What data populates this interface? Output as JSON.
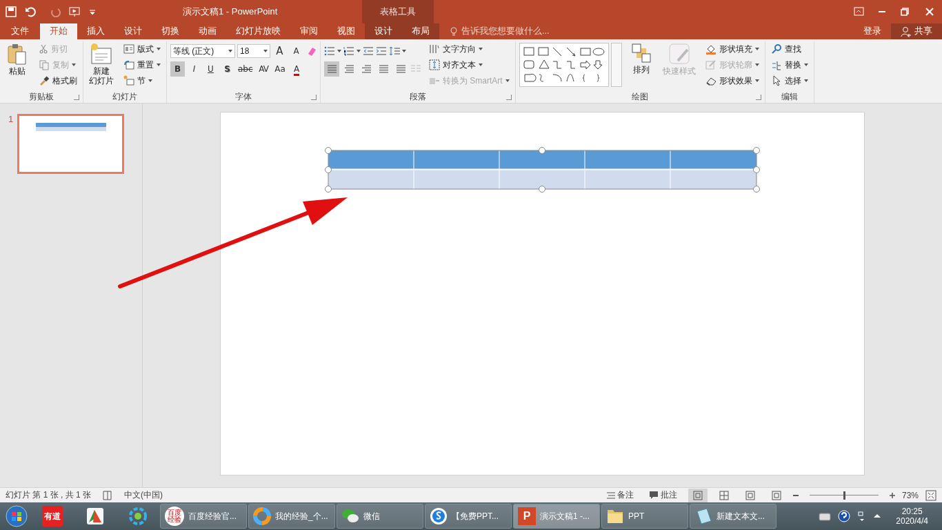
{
  "window": {
    "title": "演示文稿1 - PowerPoint",
    "context_group": "表格工具"
  },
  "tabs": [
    {
      "label": "文件",
      "kind": "file",
      "selected": false
    },
    {
      "label": "开始",
      "kind": "normal",
      "selected": true
    },
    {
      "label": "插入",
      "kind": "normal",
      "selected": false
    },
    {
      "label": "设计",
      "kind": "normal",
      "selected": false
    },
    {
      "label": "切换",
      "kind": "normal",
      "selected": false
    },
    {
      "label": "动画",
      "kind": "normal",
      "selected": false
    },
    {
      "label": "幻灯片放映",
      "kind": "normal",
      "selected": false
    },
    {
      "label": "审阅",
      "kind": "normal",
      "selected": false
    },
    {
      "label": "视图",
      "kind": "normal",
      "selected": false
    },
    {
      "label": "设计",
      "kind": "context",
      "selected": false
    },
    {
      "label": "布局",
      "kind": "context",
      "selected": false
    }
  ],
  "tell_me": {
    "placeholder": "告诉我您想要做什么..."
  },
  "account": {
    "sign_in": "登录",
    "share": "共享"
  },
  "ribbon": {
    "groups": [
      {
        "kind": "clipboard",
        "label": "剪贴板",
        "large": [
          {
            "lines": [
              "粘贴"
            ],
            "disabled": false
          }
        ],
        "small": [
          {
            "label": "剪切",
            "disabled": true
          },
          {
            "label": "复制",
            "disabled": true
          },
          {
            "label": "格式刷",
            "disabled": false
          }
        ]
      },
      {
        "kind": "slides",
        "label": "幻灯片",
        "large": [
          {
            "lines": [
              "新建",
              "幻灯片"
            ],
            "disabled": false
          }
        ],
        "small": [
          {
            "label": "版式",
            "disabled": false
          },
          {
            "label": "重置",
            "disabled": false
          },
          {
            "label": "节",
            "disabled": false
          }
        ]
      },
      {
        "kind": "font",
        "label": "字体",
        "font_name": "等线 (正文)",
        "font_size": "18",
        "size_buttons": [
          "A",
          "A"
        ],
        "format_buttons": [
          {
            "text": "B",
            "selected": true
          },
          {
            "text": "I",
            "selected": false
          },
          {
            "text": "U",
            "selected": false
          },
          {
            "text": "S",
            "selected": false
          },
          {
            "text": "abc",
            "selected": false
          },
          {
            "text": "AV",
            "selected": false
          },
          {
            "text": "Aa",
            "selected": false
          },
          {
            "text": "A",
            "selected": false
          }
        ]
      },
      {
        "kind": "paragraph",
        "label": "段落",
        "align_buttons": [
          {
            "selected": true
          },
          {
            "selected": false
          },
          {
            "selected": false
          },
          {
            "selected": false
          },
          {
            "selected": false
          }
        ],
        "small": [
          {
            "label": "文字方向",
            "disabled": false
          },
          {
            "label": "对齐文本",
            "disabled": false
          },
          {
            "label": "转换为 SmartArt",
            "disabled": true
          }
        ]
      },
      {
        "kind": "drawing",
        "label": "绘图",
        "large": [
          {
            "lines": [
              "排列"
            ],
            "disabled": false
          },
          {
            "lines": [
              "快速样式"
            ],
            "disabled": true
          }
        ],
        "small": [
          {
            "label": "形状填充",
            "disabled": false
          },
          {
            "label": "形状轮廓",
            "disabled": true
          },
          {
            "label": "形状效果",
            "disabled": false
          }
        ]
      },
      {
        "kind": "editing",
        "label": "编辑",
        "small": [
          {
            "label": "查找",
            "disabled": false
          },
          {
            "label": "替换",
            "disabled": false
          },
          {
            "label": "选择",
            "disabled": false
          }
        ]
      }
    ]
  },
  "slides_pane": {
    "slides": [
      {
        "number": "1",
        "selected": true
      }
    ]
  },
  "slide": {
    "table": {
      "selected": true
    }
  },
  "status_bar": {
    "slide_info": "幻灯片 第 1 张 , 共 1 张",
    "language": "中文(中国)",
    "notes": "备注",
    "comments": "批注",
    "views": [
      {
        "selected": true
      },
      {
        "selected": false
      },
      {
        "selected": false
      },
      {
        "selected": false
      }
    ],
    "zoom": {
      "level": 0.5,
      "reading": "73%"
    }
  },
  "taskbar": {
    "pinned": [
      {
        "kind": "youdao",
        "text": "有道"
      },
      {
        "kind": "screenshot"
      },
      {
        "kind": "flower"
      }
    ],
    "windows": [
      {
        "label": "百度经验官...",
        "kind": "baidu",
        "icon_text": "百度经验",
        "selected": false
      },
      {
        "label": "我的经验_个...",
        "kind": "ring",
        "selected": false
      },
      {
        "label": "微信",
        "kind": "chat",
        "selected": false
      },
      {
        "label": "【免费PPT...",
        "kind": "sogou",
        "selected": false
      },
      {
        "label": "演示文稿1 -...",
        "kind": "ppt",
        "icon_text": "P",
        "selected": true
      },
      {
        "label": "PPT",
        "kind": "folder",
        "selected": false
      },
      {
        "label": "新建文本文...",
        "kind": "notepad",
        "selected": false
      }
    ],
    "time": "20:25",
    "date": "2020/4/4"
  }
}
